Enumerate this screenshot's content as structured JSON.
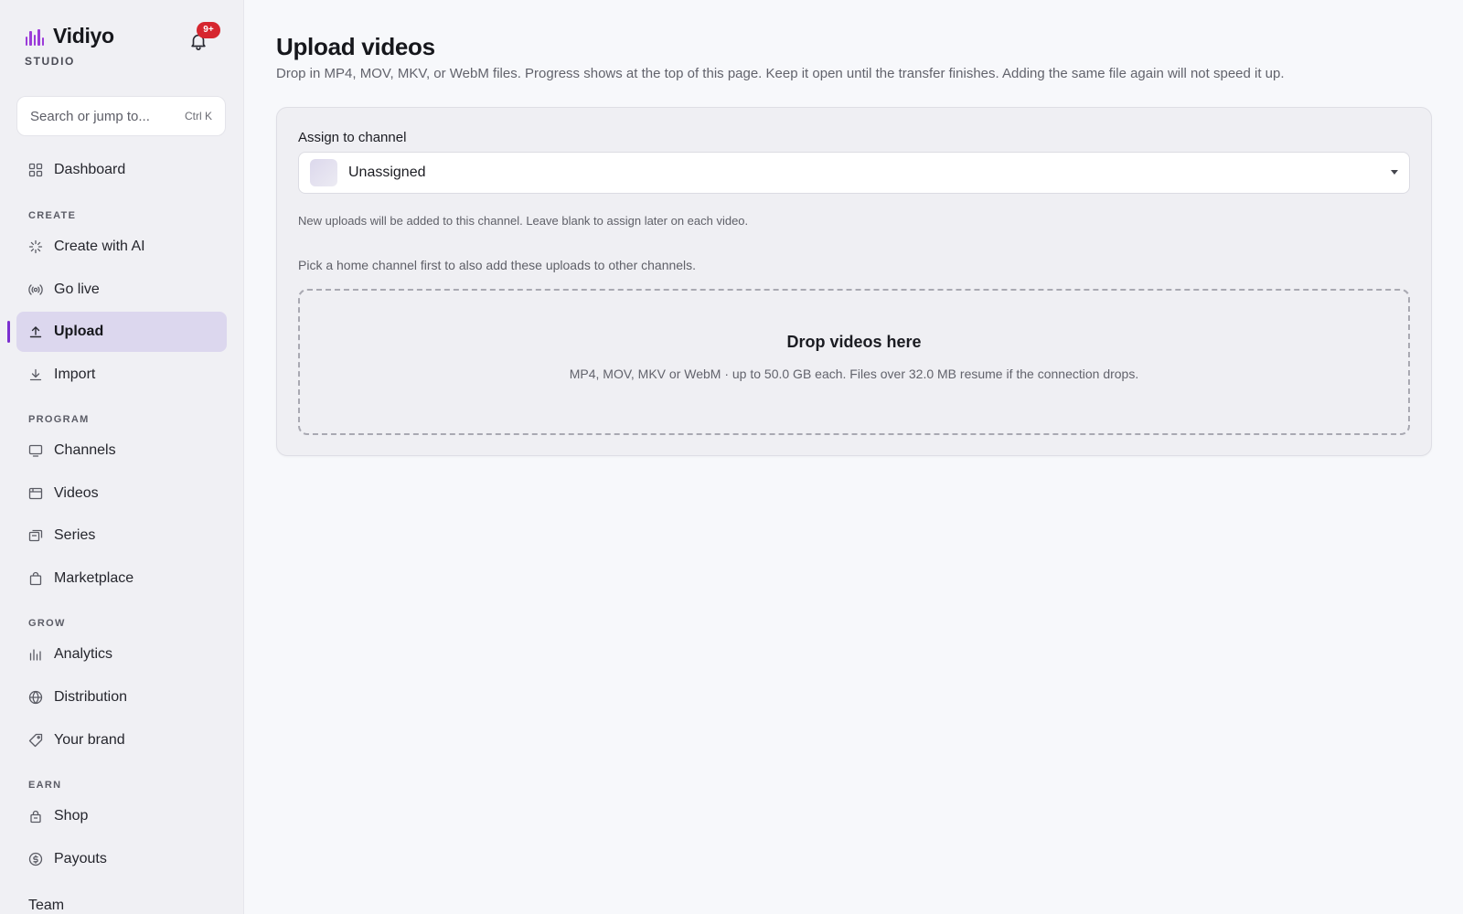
{
  "brand": {
    "name": "Vidiyo",
    "subtitle": "STUDIO",
    "accent": "#9b3bd9"
  },
  "notifications": {
    "badge": "9+",
    "badge_color": "#d6262f"
  },
  "search": {
    "placeholder": "Search or jump to...",
    "shortcut": "Ctrl K"
  },
  "nav": {
    "dashboard": "Dashboard",
    "create_section": "CREATE",
    "create_with_ai": "Create with AI",
    "go_live": "Go live",
    "upload": "Upload",
    "import": "Import",
    "program_section": "PROGRAM",
    "channels": "Channels",
    "videos": "Videos",
    "series": "Series",
    "marketplace": "Marketplace",
    "grow_section": "GROW",
    "analytics": "Analytics",
    "distribution": "Distribution",
    "your_brand": "Your brand",
    "earn_section": "EARN",
    "shop": "Shop",
    "payouts": "Payouts",
    "team": "Team",
    "active_item": "Upload",
    "active_color": "#7b2fd0"
  },
  "main": {
    "title": "Upload videos",
    "description": "Drop in MP4, MOV, MKV, or WebM files. Progress shows at the top of this page. Keep it open until the transfer finishes. Adding the same file again will not speed it up.",
    "channel_label": "Assign to channel",
    "channel_value": "Unassigned",
    "channel_help": "New uploads will be added to this channel. Leave blank to assign later on each video.",
    "home_channel_help": "Pick a home channel first to also add these uploads to other channels.",
    "dropzone_title": "Drop videos here",
    "dropzone_sub": "MP4, MOV, MKV or WebM · up to 50.0 GB each. Files over 32.0 MB resume if the connection drops."
  }
}
